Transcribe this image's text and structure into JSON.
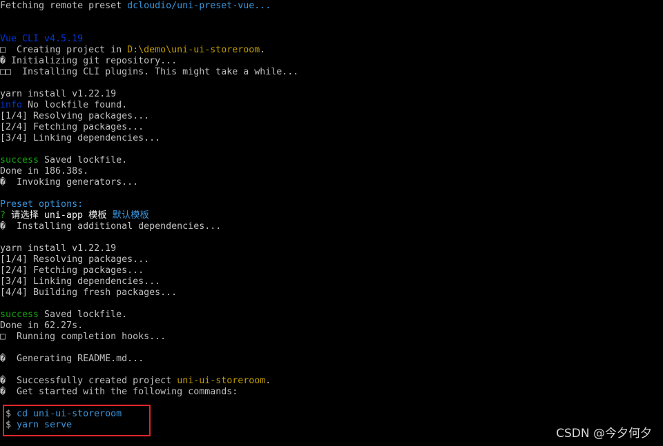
{
  "colors": {
    "background": "#000000",
    "default": "#c0c0c0",
    "blue": "#0037da",
    "green": "#13a10e",
    "cyan": "#3a96dd",
    "yellow": "#c19c00",
    "highlight_box": "#e0262b"
  },
  "lines": [
    [
      {
        "text": "Fetching remote preset ",
        "color": "default"
      },
      {
        "text": "dcloudio/uni-preset-vue...",
        "color": "cyan"
      }
    ],
    [],
    [],
    [
      {
        "text": "Vue CLI v4.5.19",
        "color": "blue"
      }
    ],
    [
      {
        "text": "□  Creating project in ",
        "color": "default"
      },
      {
        "text": "D:\\demo\\uni-ui-storeroom",
        "color": "yellow"
      },
      {
        "text": ".",
        "color": "default"
      }
    ],
    [
      {
        "text": "� Initializing git repository...",
        "color": "default"
      }
    ],
    [
      {
        "text": "□□  Installing CLI plugins. This might take a while...",
        "color": "default"
      }
    ],
    [],
    [
      {
        "text": "yarn install v1.22.19",
        "color": "default"
      }
    ],
    [
      {
        "text": "info",
        "color": "blue"
      },
      {
        "text": " No lockfile found.",
        "color": "default"
      }
    ],
    [
      {
        "text": "[1/4] Resolving packages...",
        "color": "default"
      }
    ],
    [
      {
        "text": "[2/4] Fetching packages...",
        "color": "default"
      }
    ],
    [
      {
        "text": "[3/4] Linking dependencies...",
        "color": "default"
      }
    ],
    [],
    [
      {
        "text": "success",
        "color": "green"
      },
      {
        "text": " Saved lockfile.",
        "color": "default"
      }
    ],
    [
      {
        "text": "Done in 186.38s.",
        "color": "default"
      }
    ],
    [
      {
        "text": "�  Invoking generators...",
        "color": "default"
      }
    ],
    [],
    [
      {
        "text": "Preset options:",
        "color": "cyan"
      }
    ],
    [
      {
        "text": "?",
        "color": "green"
      },
      {
        "text": " 请选择 uni-app 模板 ",
        "color": "white"
      },
      {
        "text": "默认模板",
        "color": "cyan"
      }
    ],
    [
      {
        "text": "�  Installing additional dependencies...",
        "color": "default"
      }
    ],
    [],
    [
      {
        "text": "yarn install v1.22.19",
        "color": "default"
      }
    ],
    [
      {
        "text": "[1/4] Resolving packages...",
        "color": "default"
      }
    ],
    [
      {
        "text": "[2/4] Fetching packages...",
        "color": "default"
      }
    ],
    [
      {
        "text": "[3/4] Linking dependencies...",
        "color": "default"
      }
    ],
    [
      {
        "text": "[4/4] Building fresh packages...",
        "color": "default"
      }
    ],
    [],
    [
      {
        "text": "success",
        "color": "green"
      },
      {
        "text": " Saved lockfile.",
        "color": "default"
      }
    ],
    [
      {
        "text": "Done in 62.27s.",
        "color": "default"
      }
    ],
    [
      {
        "text": "□  Running completion hooks...",
        "color": "default"
      }
    ],
    [],
    [
      {
        "text": "�  Generating README.md...",
        "color": "default"
      }
    ],
    [],
    [
      {
        "text": "�  Successfully created project ",
        "color": "default"
      },
      {
        "text": "uni-ui-storeroom",
        "color": "yellow"
      },
      {
        "text": ".",
        "color": "default"
      }
    ],
    [
      {
        "text": "�  Get started with the following commands:",
        "color": "default"
      }
    ],
    [],
    [
      {
        "text": " $ ",
        "color": "default"
      },
      {
        "text": "cd uni-ui-storeroom",
        "color": "cyan"
      }
    ],
    [
      {
        "text": " $ ",
        "color": "default"
      },
      {
        "text": "yarn serve",
        "color": "cyan"
      }
    ]
  ],
  "watermark": "CSDN @今夕何夕"
}
